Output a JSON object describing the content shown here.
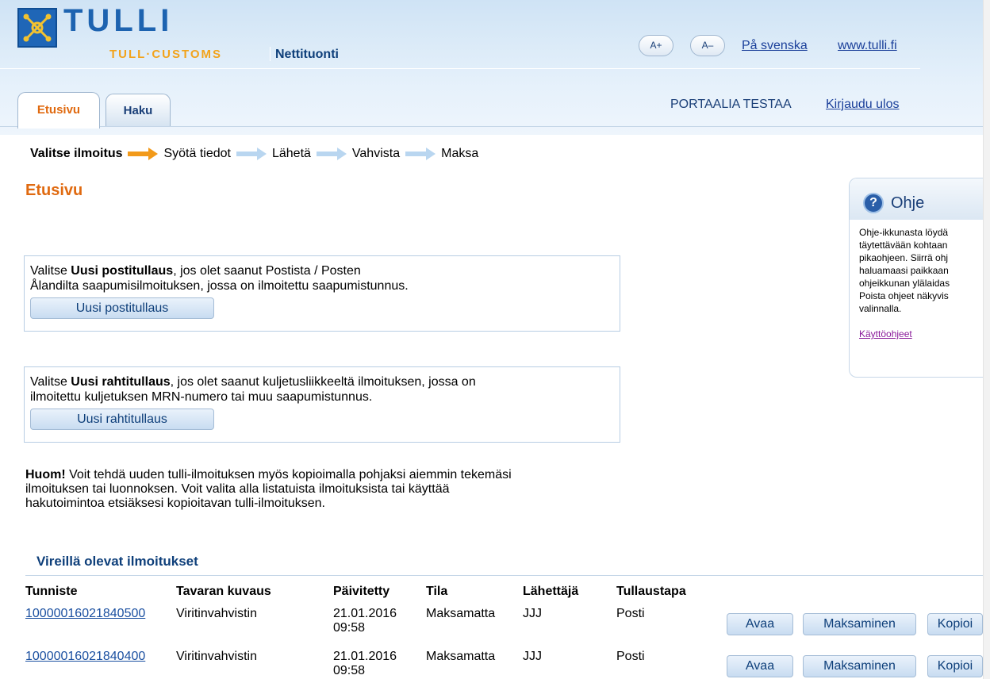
{
  "header": {
    "brand": "TULLI",
    "brand_sub": "TULL·CUSTOMS",
    "service": "Nettituonti",
    "font_larger": "A+",
    "font_smaller": "A–",
    "lang_link": "På svenska",
    "site_link": "www.tulli.fi",
    "user": "PORTAALIA TESTAA",
    "logout": "Kirjaudu ulos"
  },
  "tabs": [
    {
      "label": "Etusivu",
      "active": true
    },
    {
      "label": "Haku",
      "active": false
    }
  ],
  "steps": [
    {
      "label": "Valitse ilmoitus",
      "current": true
    },
    {
      "label": "Syötä tiedot",
      "current": false
    },
    {
      "label": "Lähetä",
      "current": false
    },
    {
      "label": "Vahvista",
      "current": false
    },
    {
      "label": "Maksa",
      "current": false
    }
  ],
  "page_title": "Etusivu",
  "option_post": {
    "prefix": "Valitse ",
    "bold": "Uusi postitullaus",
    "line1_rest": ", jos olet saanut Postista / Posten",
    "line2": "Ålandilta saapumisilmoituksen, jossa on ilmoitettu saapumistunnus.",
    "button": "Uusi postitullaus"
  },
  "option_freight": {
    "prefix": "Valitse ",
    "bold": "Uusi rahtitullaus",
    "line1_rest": ", jos olet saanut kuljetusliikkeeltä ilmoituksen, jossa on",
    "line2": "ilmoitettu kuljetuksen MRN-numero tai muu saapumistunnus.",
    "button": "Uusi rahtitullaus"
  },
  "note": {
    "bold": "Huom!",
    "line1_rest": " Voit tehdä uuden tulli-ilmoituksen myös kopioimalla pohjaksi aiemmin tekemäsi",
    "line2": "ilmoituksen tai luonnoksen. Voit valita alla listatuista ilmoituksista tai käyttää",
    "line3": "hakutoimintoa etsiäksesi kopioitavan tulli-ilmoituksen."
  },
  "help": {
    "title": "Ohje",
    "lines": [
      "Ohje-ikkunasta löydä",
      "täytettävään kohtaan",
      "pikaohjeen. Siirrä ohj",
      "haluamaasi paikkaan",
      "ohjeikkunan ylälaidas",
      "Poista ohjeet näkyvis",
      "valinnalla."
    ],
    "link": "Käyttöohjeet"
  },
  "pending": {
    "title": "Vireillä olevat ilmoitukset",
    "columns": [
      "Tunniste",
      "Tavaran kuvaus",
      "Päivitetty",
      "Tila",
      "Lähettäjä",
      "Tullaustapa"
    ],
    "rows": [
      {
        "id": "10000016021840500",
        "description": "Viritinvahvistin",
        "date": "21.01.2016",
        "time": "09:58",
        "status": "Maksamatta",
        "sender": "JJJ",
        "method": "Posti"
      },
      {
        "id": "10000016021840400",
        "description": "Viritinvahvistin",
        "date": "21.01.2016",
        "time": "09:58",
        "status": "Maksamatta",
        "sender": "JJJ",
        "method": "Posti"
      }
    ],
    "actions": {
      "open": "Avaa",
      "pay": "Maksaminen",
      "copy": "Kopioi"
    }
  },
  "colors": {
    "accent_orange": "#e06a10",
    "brand_blue": "#1d63b0",
    "link_blue": "#1a4fa0"
  }
}
